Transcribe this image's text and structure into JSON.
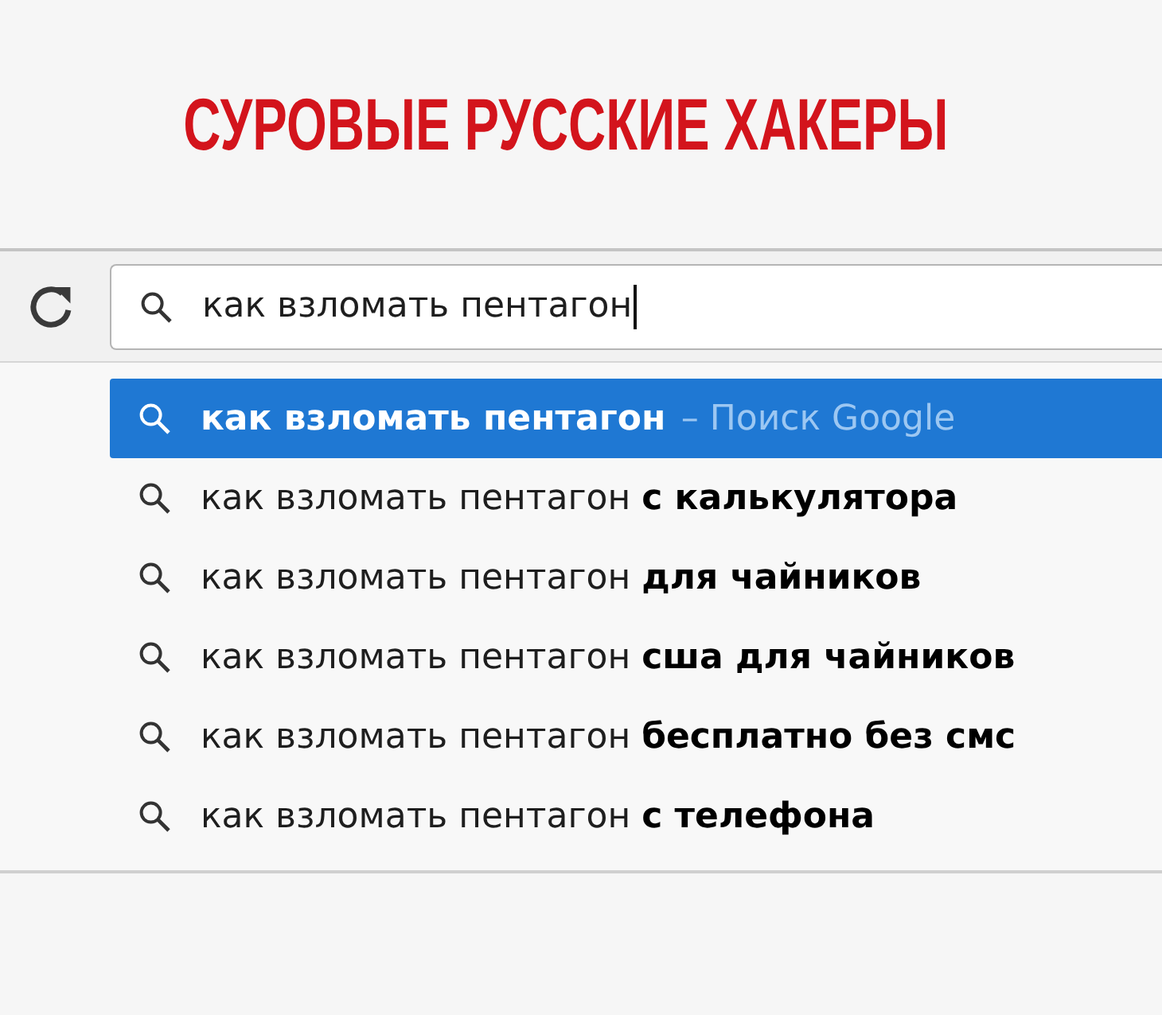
{
  "title": "СУРОВЫЕ РУССКИЕ ХАКЕРЫ",
  "toolbar": {
    "address_field": {
      "value": "как взломать пентагон"
    }
  },
  "suggestions": [
    {
      "text": "как взломать пентагон",
      "hint": "– Поиск Google",
      "selected": true
    },
    {
      "text": "как взломать пентагон **с калькулятора**",
      "selected": false
    },
    {
      "text": "как взломать пентагон **для чайников**",
      "selected": false
    },
    {
      "text": "как взломать пентагон **сша для чайников**",
      "selected": false
    },
    {
      "text": "как взломать пентагон **бесплатно без смс**",
      "selected": false
    },
    {
      "text": "как взломать пентагон **с телефона**",
      "selected": false
    }
  ]
}
